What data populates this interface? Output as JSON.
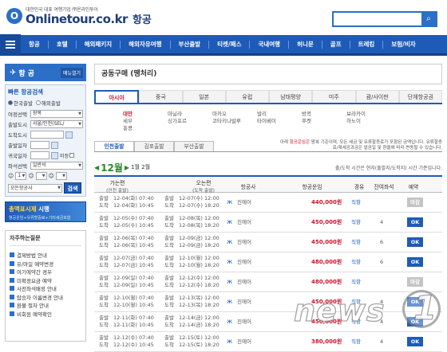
{
  "header": {
    "tagline": "대한민국 대표 여행기업 ㈜온라인투어",
    "logo_name": "Onlinetour.co.kr",
    "section": "항공",
    "search_placeholder": "",
    "search_icon": "magnifier-icon"
  },
  "nav": {
    "items": [
      "항공",
      "호텔",
      "해외패키지",
      "해외자유여행",
      "부산출발",
      "티켓/패스",
      "국내여행",
      "허니문",
      "골프",
      "트레킹",
      "보험/비자"
    ]
  },
  "sidebar": {
    "title": "항 공",
    "menu_label": "메뉴열기",
    "search_title": "빠른 항공검색",
    "trip_options": [
      "한국출발",
      "해외출발"
    ],
    "trip_selected": "한국출발",
    "fields": [
      {
        "label": "여정선택",
        "value": "왕복"
      },
      {
        "label": "출발도시",
        "value": "서울/인천(SEL/"
      },
      {
        "label": "도착도시",
        "value": ""
      },
      {
        "label": "출발일자",
        "value": ""
      },
      {
        "label": "귀국일자",
        "value": ""
      },
      {
        "label": "좌석선택",
        "value": "일반석"
      }
    ],
    "flex_date_label": "미정",
    "passenger_count": "1",
    "airline_select": "모든항공사",
    "search_button": "검색",
    "banner_title": "총액표시제 시행",
    "banner_title_highlight": "총액표시제",
    "banner_sub": "항공운임+유류할증료+기타세금포함",
    "faq_title": "자주하는질문",
    "faq_items": [
      "결제방법 안내",
      "유/마일 예약변경",
      "여기에약간 경우",
      "미확정요금 예약",
      "사전좌석배정 안내",
      "탑승자 이름변경 안내",
      "환불 절차 안내",
      "비회원 예약확인"
    ]
  },
  "main": {
    "page_title": "공동구매 (땡처리)",
    "regions": [
      "아시아",
      "중국",
      "일본",
      "유럽",
      "남태평양",
      "미주",
      "괌/사이판",
      "단체항공권"
    ],
    "active_region": "아시아",
    "cities": [
      {
        "name": "대만",
        "highlight": true
      },
      {
        "name": "세부",
        "highlight": false
      },
      {
        "name": "홍콩",
        "highlight": false
      },
      {
        "name": "마닐라",
        "highlight": false
      },
      {
        "name": "싱가포르",
        "highlight": false
      },
      {
        "name": "마카오",
        "highlight": false
      },
      {
        "name": "코타키나발루",
        "highlight": false
      },
      {
        "name": "발리",
        "highlight": false
      },
      {
        "name": "타이베이",
        "highlight": false
      },
      {
        "name": "방콕",
        "highlight": false
      },
      {
        "name": "푸켓",
        "highlight": false
      },
      {
        "name": "보라카이",
        "highlight": false
      },
      {
        "name": "하노이",
        "highlight": false
      }
    ],
    "subtabs": [
      "인천출발",
      "김포출발",
      "부산출발"
    ],
    "active_subtab": "인천출발",
    "notice_prefix": "아래 ",
    "notice_highlight": "항공운임은",
    "notice_rest": " 왕복 기준이며, 모든 세금 및 유류할증료가 포함된 금액입니다. 유류할증료/제세공과금은 발권일 및 환율에 따라 변동될 수 있습니다.",
    "month": "12월",
    "month_prefix_arrow": "◀",
    "month_next_arrow": "▶",
    "day_range": "1월 2월",
    "sort_info": "출/도착 시간은 현지(출발지/도착지) 시간 기준입니다.",
    "columns": {
      "departure": "가는편",
      "departure_sub": "(인천 출발)",
      "return": "오는편",
      "return_sub": "(도착 출발)",
      "airline": "항공사",
      "fare": "항공운임",
      "route": "경유",
      "seats": "잔여좌석",
      "reserve": "예약"
    },
    "flights": [
      {
        "dep_out": "12-04(화) 07:40",
        "arr_out": "12-04(화) 10:45",
        "dep_back": "12-07(수) 12:00",
        "arr_back": "12-07(수) 18:20",
        "airline": "진에어",
        "price": "440,000원",
        "route": "직항",
        "seats": "",
        "status": "마감"
      },
      {
        "dep_out": "12-05(수) 07:40",
        "arr_out": "12-05(수) 10:45",
        "dep_back": "12-08(목) 12:00",
        "arr_back": "12-08(목) 18:20",
        "airline": "진에어",
        "price": "450,000원",
        "route": "직항",
        "seats": "4",
        "status": "OK"
      },
      {
        "dep_out": "12-06(목) 07:40",
        "arr_out": "12-06(목) 10:45",
        "dep_back": "12-09(금) 12:00",
        "arr_back": "12-09(금) 18:20",
        "airline": "진에어",
        "price": "450,000원",
        "route": "직항",
        "seats": "6",
        "status": "OK"
      },
      {
        "dep_out": "12-07(금) 07:40",
        "arr_out": "12-07(금) 10:45",
        "dep_back": "12-10(월) 12:00",
        "arr_back": "12-10(월) 18:20",
        "airline": "진에어",
        "price": "480,000원",
        "route": "직항",
        "seats": "6",
        "status": "OK"
      },
      {
        "dep_out": "12-09(일) 07:40",
        "arr_out": "12-09(일) 10:45",
        "dep_back": "12-12(수) 12:00",
        "arr_back": "12-12(수) 18:20",
        "airline": "진에어",
        "price": "480,000원",
        "route": "직항",
        "seats": "",
        "status": "마감"
      },
      {
        "dep_out": "12-10(월) 07:40",
        "arr_out": "12-10(월) 10:45",
        "dep_back": "12-13(목) 12:00",
        "arr_back": "12-13(목) 18:20",
        "airline": "진에어",
        "price": "450,000원",
        "route": "직항",
        "seats": "4",
        "status": "OK"
      },
      {
        "dep_out": "12-11(화) 07:40",
        "arr_out": "12-11(화) 10:45",
        "dep_back": "12-14(금) 12:00",
        "arr_back": "12-14(금) 18:20",
        "airline": "진에어",
        "price": "450,000원",
        "route": "직항",
        "seats": "4",
        "status": "OK"
      },
      {
        "dep_out": "12-12(수) 07:40",
        "arr_out": "12-12(수) 10:45",
        "dep_back": "12-15(토) 12:00",
        "arr_back": "12-15(토) 18:20",
        "airline": "진에어",
        "price": "380,000원",
        "route": "직항",
        "seats": "4",
        "status": "OK"
      }
    ],
    "row_labels": {
      "dep": "출발",
      "arr": "도착"
    }
  },
  "watermark": {
    "text": "news",
    "digit": "1"
  },
  "colors": {
    "brand": "#1e5bb8",
    "price": "#c8142b",
    "month": "#2a8a2a"
  }
}
